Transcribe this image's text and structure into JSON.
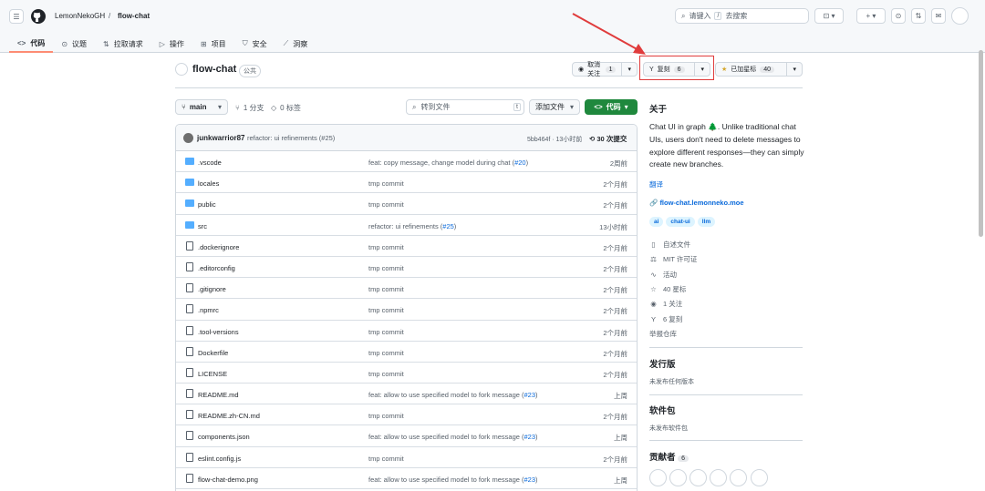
{
  "header": {
    "owner": "LemonNekoGH",
    "separator": "/",
    "repo": "flow-chat",
    "search_placeholder": "请键入",
    "search_key": "/",
    "search_suffix": "去搜索",
    "plus_label": "+"
  },
  "tabs": [
    {
      "label": "代码",
      "icon": "<>"
    },
    {
      "label": "议题",
      "icon": "⊙"
    },
    {
      "label": "拉取请求",
      "icon": "⇅"
    },
    {
      "label": "操作",
      "icon": "▷"
    },
    {
      "label": "项目",
      "icon": "⊞"
    },
    {
      "label": "安全",
      "icon": "⛉"
    },
    {
      "label": "洞察",
      "icon": "⟋"
    }
  ],
  "repo": {
    "name": "flow-chat",
    "visibility": "公共",
    "watch_label": "取消关注",
    "watch_count": "1",
    "fork_label": "复刻",
    "fork_count": "6",
    "star_label": "已加星标",
    "star_count": "40"
  },
  "toolbar": {
    "branch": "main",
    "branches": "1 分支",
    "tags": "0 标签",
    "goto_placeholder": "转到文件",
    "goto_key": "t",
    "add_file": "添加文件",
    "code": "代码"
  },
  "last_commit": {
    "author": "junkwarrior87",
    "message": "refactor: ui refinements (#25)",
    "sha": "5bb464f · 13小时前",
    "commits": "30 次提交"
  },
  "files": [
    {
      "type": "folder",
      "name": ".vscode",
      "msg": "feat: copy message, change model during chat (",
      "pr": "#20",
      "msg_end": ")",
      "date": "2周前"
    },
    {
      "type": "folder",
      "name": "locales",
      "msg": "tmp commit",
      "pr": "",
      "msg_end": "",
      "date": "2个月前"
    },
    {
      "type": "folder",
      "name": "public",
      "msg": "tmp commit",
      "pr": "",
      "msg_end": "",
      "date": "2个月前"
    },
    {
      "type": "folder",
      "name": "src",
      "msg": "refactor: ui refinements (",
      "pr": "#25",
      "msg_end": ")",
      "date": "13小时前"
    },
    {
      "type": "file",
      "name": ".dockerignore",
      "msg": "tmp commit",
      "pr": "",
      "msg_end": "",
      "date": "2个月前"
    },
    {
      "type": "file",
      "name": ".editorconfig",
      "msg": "tmp commit",
      "pr": "",
      "msg_end": "",
      "date": "2个月前"
    },
    {
      "type": "file",
      "name": ".gitignore",
      "msg": "tmp commit",
      "pr": "",
      "msg_end": "",
      "date": "2个月前"
    },
    {
      "type": "file",
      "name": ".npmrc",
      "msg": "tmp commit",
      "pr": "",
      "msg_end": "",
      "date": "2个月前"
    },
    {
      "type": "file",
      "name": ".tool-versions",
      "msg": "tmp commit",
      "pr": "",
      "msg_end": "",
      "date": "2个月前"
    },
    {
      "type": "file",
      "name": "Dockerfile",
      "msg": "tmp commit",
      "pr": "",
      "msg_end": "",
      "date": "2个月前"
    },
    {
      "type": "file",
      "name": "LICENSE",
      "msg": "tmp commit",
      "pr": "",
      "msg_end": "",
      "date": "2个月前"
    },
    {
      "type": "file",
      "name": "README.md",
      "msg": "feat: allow to use specified model to fork message (",
      "pr": "#23",
      "msg_end": ")",
      "date": "上周"
    },
    {
      "type": "file",
      "name": "README.zh-CN.md",
      "msg": "tmp commit",
      "pr": "",
      "msg_end": "",
      "date": "2个月前"
    },
    {
      "type": "file",
      "name": "components.json",
      "msg": "feat: allow to use specified model to fork message (",
      "pr": "#23",
      "msg_end": ")",
      "date": "上周"
    },
    {
      "type": "file",
      "name": "eslint.config.js",
      "msg": "tmp commit",
      "pr": "",
      "msg_end": "",
      "date": "2个月前"
    },
    {
      "type": "file",
      "name": "flow-chat-demo.png",
      "msg": "feat: allow to use specified model to fork message (",
      "pr": "#23",
      "msg_end": ")",
      "date": "上周"
    }
  ],
  "sidebar": {
    "about_title": "关于",
    "description": "Chat UI in graph 🌲. Unlike traditional chat UIs, users don't need to delete messages to explore different responses—they can simply create new branches.",
    "translate": "翻译",
    "website": "flow-chat.lemonneko.moe",
    "topics": [
      "ai",
      "chat-ui",
      "llm"
    ],
    "items": [
      {
        "icon": "📖",
        "label": "自述文件"
      },
      {
        "icon": "⚖",
        "label": "MIT 许可证"
      },
      {
        "icon": "∿",
        "label": "活动"
      },
      {
        "icon": "☆",
        "label": "40 星标"
      },
      {
        "icon": "◉",
        "label": "1 关注"
      },
      {
        "icon": "Y",
        "label": "6 复刻"
      }
    ],
    "report": "举报仓库",
    "releases_title": "发行版",
    "releases_text": "未发布任何版本",
    "packages_title": "软件包",
    "packages_text": "未发布软件包",
    "contributors_title": "贡献者",
    "contributors_count": "6"
  },
  "colors": {
    "accent": "#1f883d",
    "link": "#0969da",
    "annotation": "#e03c3c"
  }
}
